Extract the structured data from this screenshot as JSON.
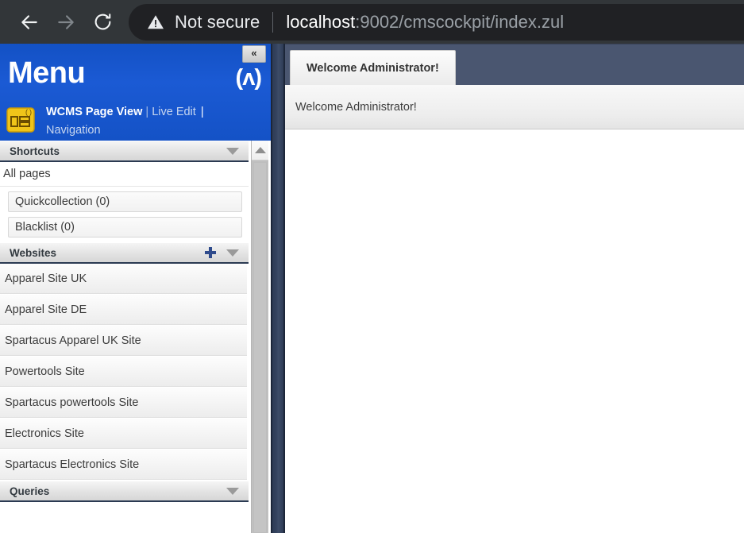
{
  "browser": {
    "back_icon": "arrow-left-icon",
    "forward_icon": "arrow-right-icon",
    "reload_icon": "reload-icon",
    "security_icon": "warning-triangle-icon",
    "security_label": "Not secure",
    "url_host": "localhost",
    "url_rest": ":9002/cmscockpit/index.zul",
    "url_full": "localhost:9002/cmscockpit/index.zul"
  },
  "sidebar": {
    "title": "Menu",
    "collapse_label": "«",
    "logo_text": "(ʌ)",
    "perspective": {
      "icon": "wcms-page-view-icon",
      "active_link": "WCMS Page View",
      "separator": "|",
      "second_link": "Live Edit",
      "trailing_pipe": "|",
      "third_link": "Navigation"
    },
    "groups": [
      {
        "title": "Shortcuts",
        "has_add": false,
        "collapse_icon": "chevron-down-icon",
        "plain_items": [
          "All pages"
        ],
        "button_items": [
          "Quickcollection (0)",
          "Blacklist (0)"
        ]
      },
      {
        "title": "Websites",
        "has_add": true,
        "add_icon": "plus-icon",
        "collapse_icon": "chevron-down-icon",
        "site_items": [
          "Apparel Site UK",
          "Apparel Site DE",
          "Spartacus Apparel UK Site",
          "Powertools Site",
          "Spartacus powertools Site",
          "Electronics Site",
          "Spartacus Electronics Site"
        ]
      },
      {
        "title": "Queries",
        "has_add": false,
        "collapse_icon": "chevron-down-icon",
        "site_items": []
      }
    ],
    "scrollbar": {
      "up_icon": "scroll-up-arrow-icon"
    }
  },
  "main": {
    "tabs": [
      {
        "label": "Welcome Administrator!",
        "active": true
      }
    ],
    "panel_text": "Welcome Administrator!"
  },
  "colors": {
    "menu_blue": "#1656cc",
    "tabstrip": "#4a5670",
    "splitter": "#33415c",
    "browser_chrome": "#323639",
    "omnibox": "#202124",
    "accent_plus": "#2f4b8c"
  }
}
